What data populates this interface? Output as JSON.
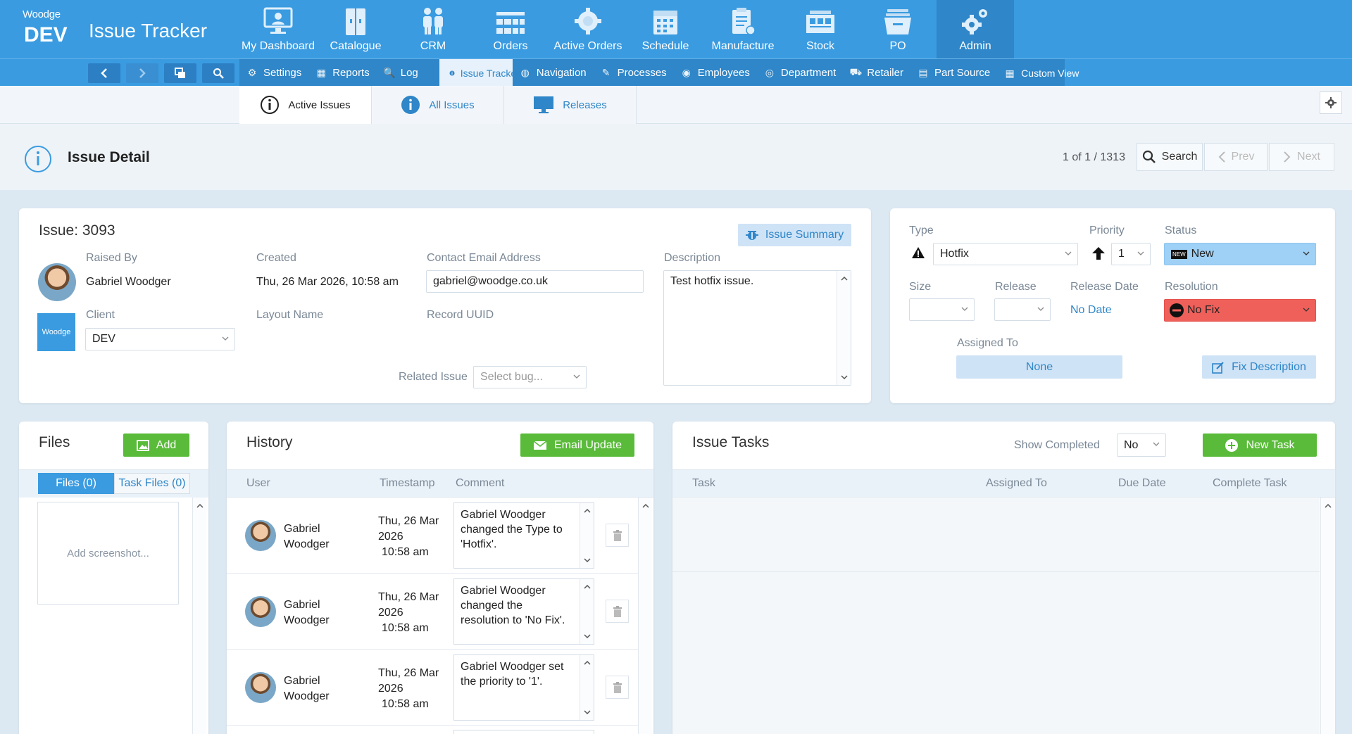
{
  "app": {
    "logo": "Woodge",
    "env": "DEV",
    "title": "Issue Tracker"
  },
  "modules": [
    {
      "label": "My Dashboard",
      "icon": "dashboard-icon"
    },
    {
      "label": "Catalogue",
      "icon": "catalogue-icon"
    },
    {
      "label": "CRM",
      "icon": "people-icon"
    },
    {
      "label": "Orders",
      "icon": "orders-icon"
    },
    {
      "label": "Active Orders",
      "icon": "gear-icon"
    },
    {
      "label": "Schedule",
      "icon": "calendar-icon"
    },
    {
      "label": "Manufacture",
      "icon": "clipboard-icon"
    },
    {
      "label": "Stock",
      "icon": "warehouse-icon"
    },
    {
      "label": "PO",
      "icon": "tray-icon"
    },
    {
      "label": "Admin",
      "icon": "gears-icon",
      "active": true
    }
  ],
  "subnav": [
    {
      "label": "Settings",
      "icon": "gear-icon"
    },
    {
      "label": "Reports",
      "icon": "report-icon"
    },
    {
      "label": "Log",
      "icon": "log-icon"
    },
    {
      "label": "Issue Tracker",
      "icon": "info-icon",
      "active": true
    },
    {
      "label": "Navigation",
      "icon": "globe-icon"
    },
    {
      "label": "Processes",
      "icon": "edit-icon"
    },
    {
      "label": "Employees",
      "icon": "person-icon"
    },
    {
      "label": "Department",
      "icon": "department-icon"
    },
    {
      "label": "Retailer",
      "icon": "cart-icon"
    },
    {
      "label": "Part Source",
      "icon": "source-icon"
    },
    {
      "label": "Custom View",
      "icon": "grid-icon"
    }
  ],
  "issue_tabs": [
    {
      "label": "Active Issues",
      "active": true
    },
    {
      "label": "All Issues"
    },
    {
      "label": "Releases"
    }
  ],
  "page": {
    "title": "Issue Detail",
    "pager": "1 of 1 / 1313",
    "search": "Search",
    "prev": "Prev",
    "next": "Next"
  },
  "issue": {
    "heading": "Issue: 3093",
    "summary_button": "Issue Summary",
    "raised_by_label": "Raised By",
    "raised_by": "Gabriel Woodger",
    "created_label": "Created",
    "created": "Thu, 26 Mar 2026, 10:58 am",
    "contact_label": "Contact Email Address",
    "contact": "gabriel@woodge.co.uk",
    "description_label": "Description",
    "description": "Test hotfix issue.",
    "client_label": "Client",
    "client_logo": "Woodge",
    "client": "DEV",
    "layout_label": "Layout Name",
    "uuid_label": "Record UUID",
    "related_label": "Related Issue",
    "related_placeholder": "Select bug..."
  },
  "props": {
    "type_label": "Type",
    "type": "Hotfix",
    "priority_label": "Priority",
    "priority": "1",
    "status_label": "Status",
    "status_badge": "NEW",
    "status": "New",
    "size_label": "Size",
    "release_label": "Release",
    "release_date_label": "Release Date",
    "release_date": "No Date",
    "resolution_label": "Resolution",
    "resolution": "No Fix",
    "assigned_label": "Assigned To",
    "assigned": "None",
    "fix_button": "Fix Description",
    "status_color": "#9fd0f5",
    "resolution_color": "#f0605a"
  },
  "files": {
    "title": "Files",
    "add": "Add",
    "tab_files": "Files (0)",
    "tab_task_files": "Task Files (0)",
    "placeholder": "Add screenshot..."
  },
  "history": {
    "title": "History",
    "email_button": "Email Update",
    "col_user": "User",
    "col_timestamp": "Timestamp",
    "col_comment": "Comment",
    "rows": [
      {
        "user1": "Gabriel",
        "user2": "Woodger",
        "ts1": "Thu, 26 Mar",
        "ts2": "2026",
        "ts3": "10:58 am",
        "comment": "Gabriel Woodger changed the Type to 'Hotfix'."
      },
      {
        "user1": "Gabriel",
        "user2": "Woodger",
        "ts1": "Thu, 26 Mar",
        "ts2": "2026",
        "ts3": "10:58 am",
        "comment": "Gabriel Woodger changed the resolution to 'No Fix'."
      },
      {
        "user1": "Gabriel",
        "user2": "Woodger",
        "ts1": "Thu, 26 Mar",
        "ts2": "2026",
        "ts3": "10:58 am",
        "comment": "Gabriel Woodger set the priority to '1'."
      }
    ]
  },
  "tasks": {
    "title": "Issue Tasks",
    "show_completed_label": "Show Completed",
    "show_completed": "No",
    "new_task": "New Task",
    "col_task": "Task",
    "col_assigned": "Assigned To",
    "col_due": "Due Date",
    "col_complete": "Complete Task"
  }
}
